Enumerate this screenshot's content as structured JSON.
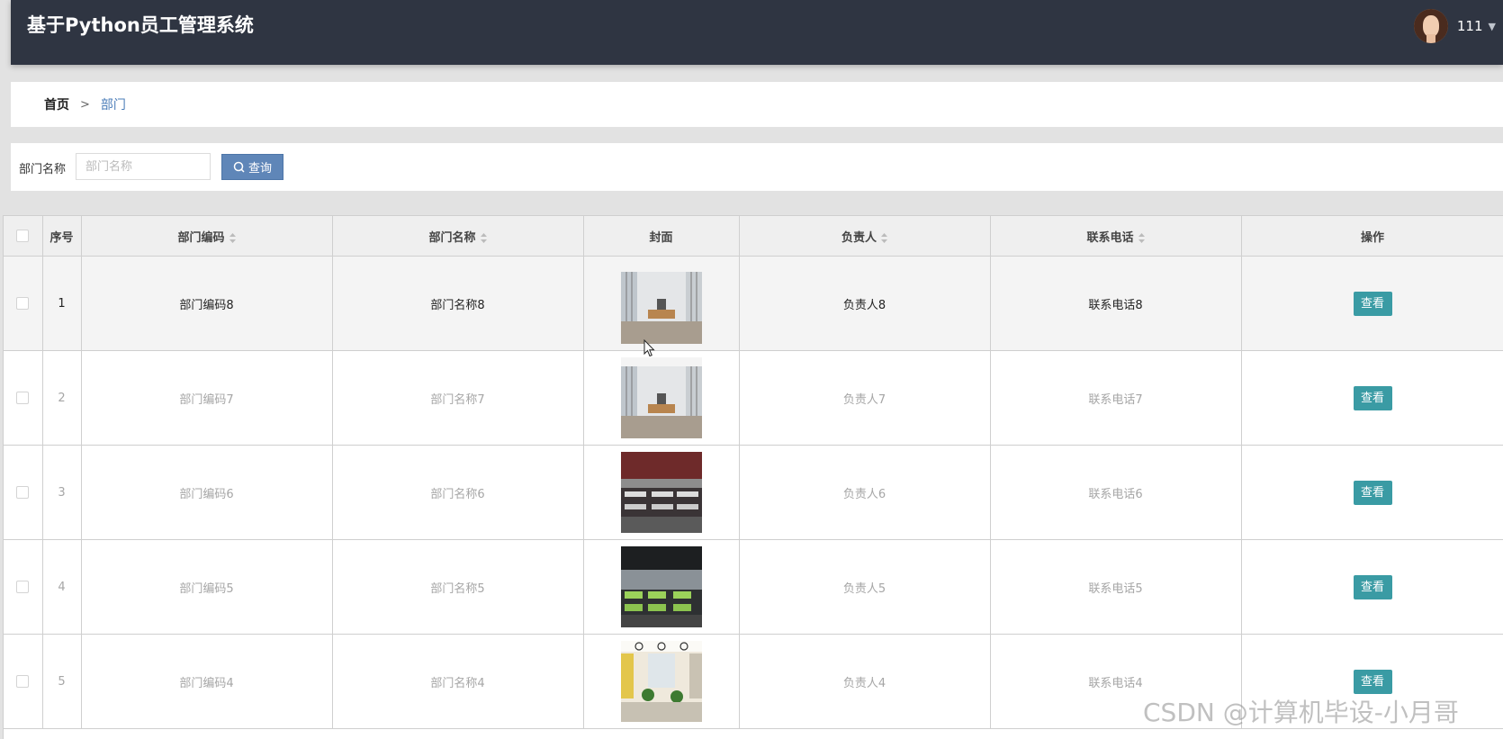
{
  "header": {
    "title": "基于Python员工管理系统",
    "username": "111"
  },
  "breadcrumb": {
    "home": "首页",
    "separator": ">",
    "current": "部门"
  },
  "search": {
    "label": "部门名称",
    "placeholder": "部门名称",
    "button_label": "查询"
  },
  "table": {
    "columns": {
      "index": "序号",
      "code": "部门编码",
      "name": "部门名称",
      "cover": "封面",
      "manager": "负责人",
      "phone": "联系电话",
      "actions": "操作"
    },
    "rows": [
      {
        "index": "1",
        "code": "部门编码8",
        "name": "部门名称8",
        "manager": "负责人8",
        "phone": "联系电话8",
        "action": "查看"
      },
      {
        "index": "2",
        "code": "部门编码7",
        "name": "部门名称7",
        "manager": "负责人7",
        "phone": "联系电话7",
        "action": "查看"
      },
      {
        "index": "3",
        "code": "部门编码6",
        "name": "部门名称6",
        "manager": "负责人6",
        "phone": "联系电话6",
        "action": "查看"
      },
      {
        "index": "4",
        "code": "部门编码5",
        "name": "部门名称5",
        "manager": "负责人5",
        "phone": "联系电话5",
        "action": "查看"
      },
      {
        "index": "5",
        "code": "部门编码4",
        "name": "部门名称4",
        "manager": "负责人4",
        "phone": "联系电话4",
        "action": "查看"
      }
    ]
  },
  "watermark": "CSDN @计算机毕设-小月哥",
  "colors": {
    "header_bg": "#2f3542",
    "search_button": "#5f86b8",
    "view_button": "#3a9ba4",
    "breadcrumb_current": "#4a7cb8"
  }
}
